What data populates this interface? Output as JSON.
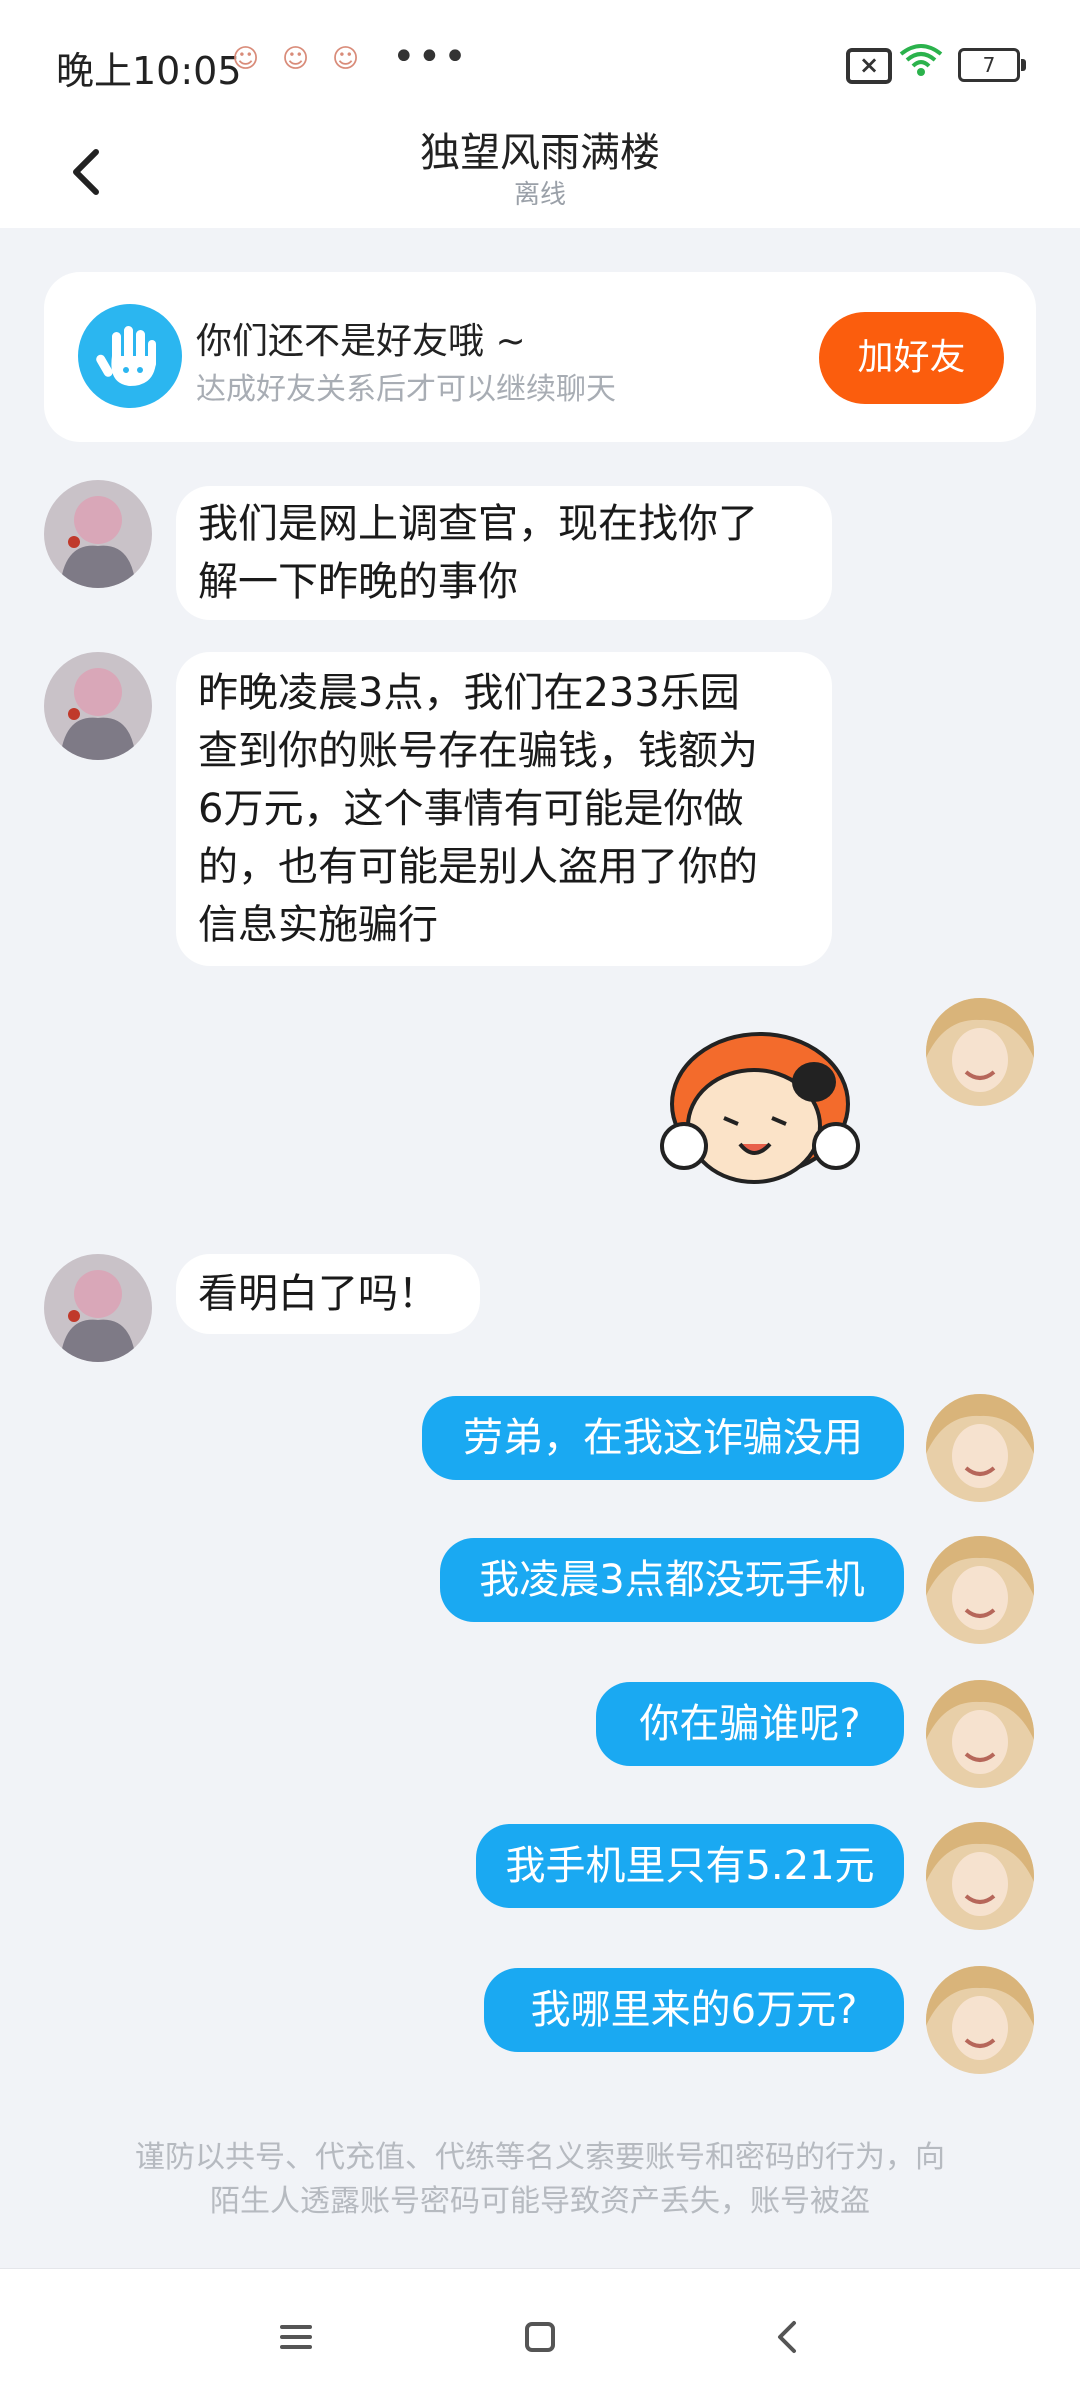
{
  "status_bar": {
    "time": "晚上10:05",
    "battery": "7"
  },
  "header": {
    "title": "独望风雨满楼",
    "status": "离线"
  },
  "friend_card": {
    "title": "你们还不是好友哦 ~",
    "subtitle": "达成好友关系后才可以继续聊天",
    "add_button": "加好友"
  },
  "messages": [
    {
      "side": "left",
      "line1": "我们是网上调查官，现在找你了",
      "line2": "解一下昨晚的事你"
    },
    {
      "side": "left",
      "lines": [
        "昨晚凌晨3点，我们在233乐园",
        "查到你的账号存在骗钱，钱额为",
        "6万元，这个事情有可能是你做",
        "的，也有可能是别人盗用了你的",
        "信息实施骗行"
      ]
    },
    {
      "side": "right",
      "type": "sticker"
    },
    {
      "side": "left",
      "text": "看明白了吗！"
    },
    {
      "side": "right",
      "text": "劳弟，在我这诈骗没用"
    },
    {
      "side": "right",
      "text": "我凌晨3点都没玩手机"
    },
    {
      "side": "right",
      "text": "你在骗谁呢?"
    },
    {
      "side": "right",
      "text": "我手机里只有5.21元"
    },
    {
      "side": "right",
      "text": "我哪里来的6万元?"
    }
  ],
  "warning": {
    "line1": "谨防以共号、代充值、代练等名义索要账号和密码的行为，向",
    "line2": "陌生人透露账号密码可能导致资产丢失，账号被盗"
  },
  "colors": {
    "accent": "#1aa9f2",
    "add_button": "#fb5d0d",
    "background": "#f1f3f7"
  },
  "icons": [
    "back-arrow-icon",
    "wave-hand-icon",
    "wifi-icon",
    "battery-icon",
    "menu-icon",
    "home-icon",
    "nav-back-icon"
  ]
}
